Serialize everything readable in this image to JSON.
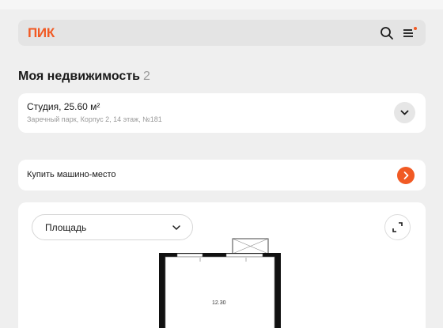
{
  "header": {
    "logo": "ПИК",
    "icons": [
      "search-icon",
      "menu-icon"
    ],
    "accent": "#f15a24"
  },
  "section": {
    "title": "Моя недвижимость",
    "count": "2"
  },
  "property": {
    "name": "Студия, 25.60 м²",
    "address": "Заречный парк, Корпус 2, 14 этаж, №181"
  },
  "parking": {
    "label": "Купить машино-место"
  },
  "plan": {
    "selector_value": "Площадь",
    "room_area": "12.30",
    "icons": [
      "chevron-down-icon",
      "expand-icon"
    ]
  }
}
